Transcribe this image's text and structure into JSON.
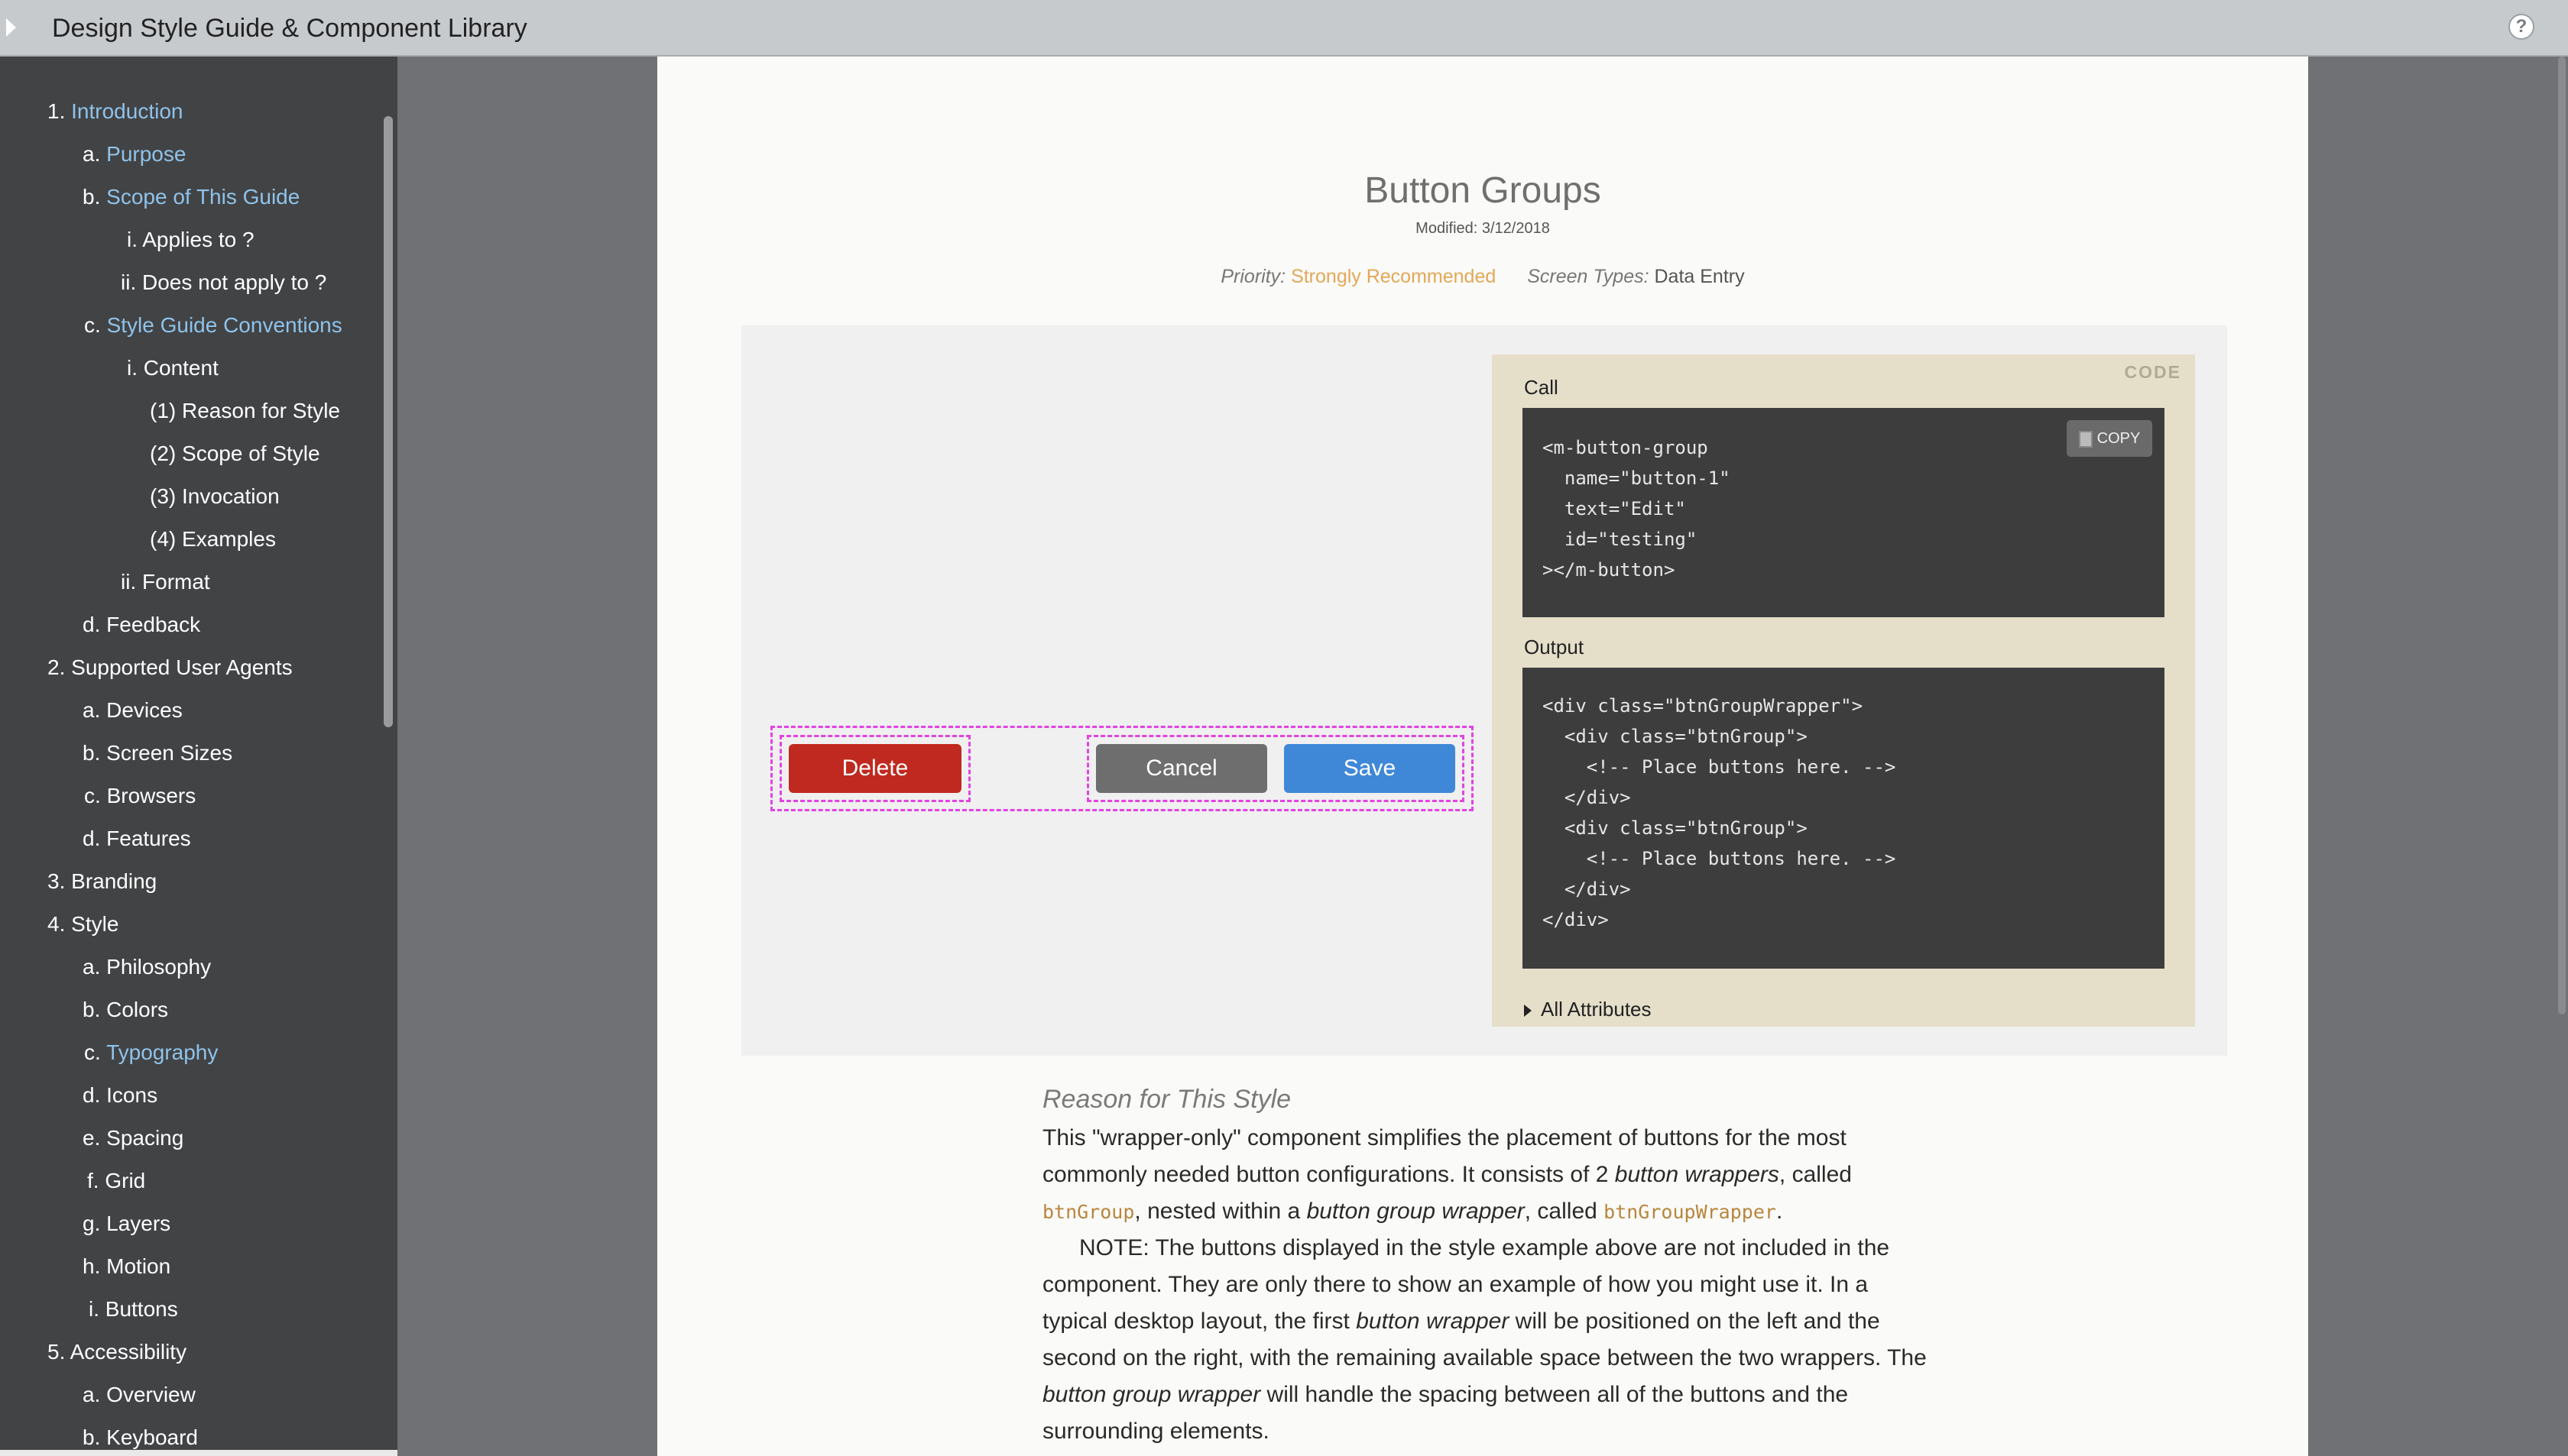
{
  "app": {
    "title": "Design Style Guide & Component Library",
    "help": "?"
  },
  "sidebar": {
    "items": [
      {
        "num": "1.",
        "label": "Introduction"
      },
      {
        "num": "a.",
        "label": "Purpose"
      },
      {
        "num": "b.",
        "label": "Scope of This Guide"
      },
      {
        "num": "i.",
        "label": "Applies to ?"
      },
      {
        "num": "ii.",
        "label": "Does not apply to ?"
      },
      {
        "num": "c.",
        "label": "Style Guide Conventions"
      },
      {
        "num": "i.",
        "label": "Content"
      },
      {
        "num": "(1)",
        "label": "Reason for Style"
      },
      {
        "num": "(2)",
        "label": "Scope of Style"
      },
      {
        "num": "(3)",
        "label": "Invocation"
      },
      {
        "num": "(4)",
        "label": "Examples"
      },
      {
        "num": "ii.",
        "label": "Format"
      },
      {
        "num": "d.",
        "label": "Feedback"
      },
      {
        "num": "2.",
        "label": "Supported User Agents"
      },
      {
        "num": "a.",
        "label": "Devices"
      },
      {
        "num": "b.",
        "label": "Screen Sizes"
      },
      {
        "num": "c.",
        "label": "Browsers"
      },
      {
        "num": "d.",
        "label": "Features"
      },
      {
        "num": "3.",
        "label": "Branding"
      },
      {
        "num": "4.",
        "label": "Style"
      },
      {
        "num": "a.",
        "label": "Philosophy"
      },
      {
        "num": "b.",
        "label": "Colors"
      },
      {
        "num": "c.",
        "label": "Typography"
      },
      {
        "num": "d.",
        "label": "Icons"
      },
      {
        "num": "e.",
        "label": "Spacing"
      },
      {
        "num": "f.",
        "label": "Grid"
      },
      {
        "num": "g.",
        "label": "Layers"
      },
      {
        "num": "h.",
        "label": "Motion"
      },
      {
        "num": "i.",
        "label": "Buttons"
      },
      {
        "num": "5.",
        "label": "Accessibility"
      },
      {
        "num": "a.",
        "label": "Overview"
      },
      {
        "num": "b.",
        "label": "Keyboard"
      }
    ]
  },
  "page": {
    "title": "Button Groups",
    "modified": "Modified: 3/12/2018",
    "priority_label": "Priority:",
    "priority_value": "Strongly Recommended",
    "screen_types_label": "Screen Types:",
    "screen_types_value": "Data Entry"
  },
  "example": {
    "delete": "Delete",
    "cancel": "Cancel",
    "save": "Save"
  },
  "code": {
    "tag": "CODE",
    "call_heading": "Call",
    "copy": "COPY",
    "call_code": "<m-button-group\n  name=\"button-1\"\n  text=\"Edit\"\n  id=\"testing\"\n></m-button>",
    "output_heading": "Output",
    "output_code": "<div class=\"btnGroupWrapper\">\n  <div class=\"btnGroup\">\n    <!-- Place buttons here. -->\n  </div>\n  <div class=\"btnGroup\">\n    <!-- Place buttons here. -->\n  </div>\n</div>",
    "all_attributes": "All Attributes"
  },
  "reason": {
    "heading": "Reason for This Style",
    "p1_a": "This \"wrapper-only\" component simplifies the placement of buttons for the most commonly needed button configurations. It consists of 2 ",
    "p1_em1": "button wrappers",
    "p1_b": ", called ",
    "p1_code1": "btnGroup",
    "p1_c": ", nested within a ",
    "p1_em2": "button group wrapper",
    "p1_d": ", called ",
    "p1_code2": "btnGroupWrapper",
    "p1_e": ".",
    "p2_a": "NOTE: The buttons displayed in the style example above are not included in the component. They are only there to show an example of how you might use it. In a typical desktop layout, the first ",
    "p2_em1": "button wrapper",
    "p2_b": " will be positioned on the left and the second on the right, with the remaining available space between the two wrappers. The ",
    "p2_em2": "button group wrapper",
    "p2_c": " will handle the spacing between all of the buttons and the surrounding elements."
  }
}
